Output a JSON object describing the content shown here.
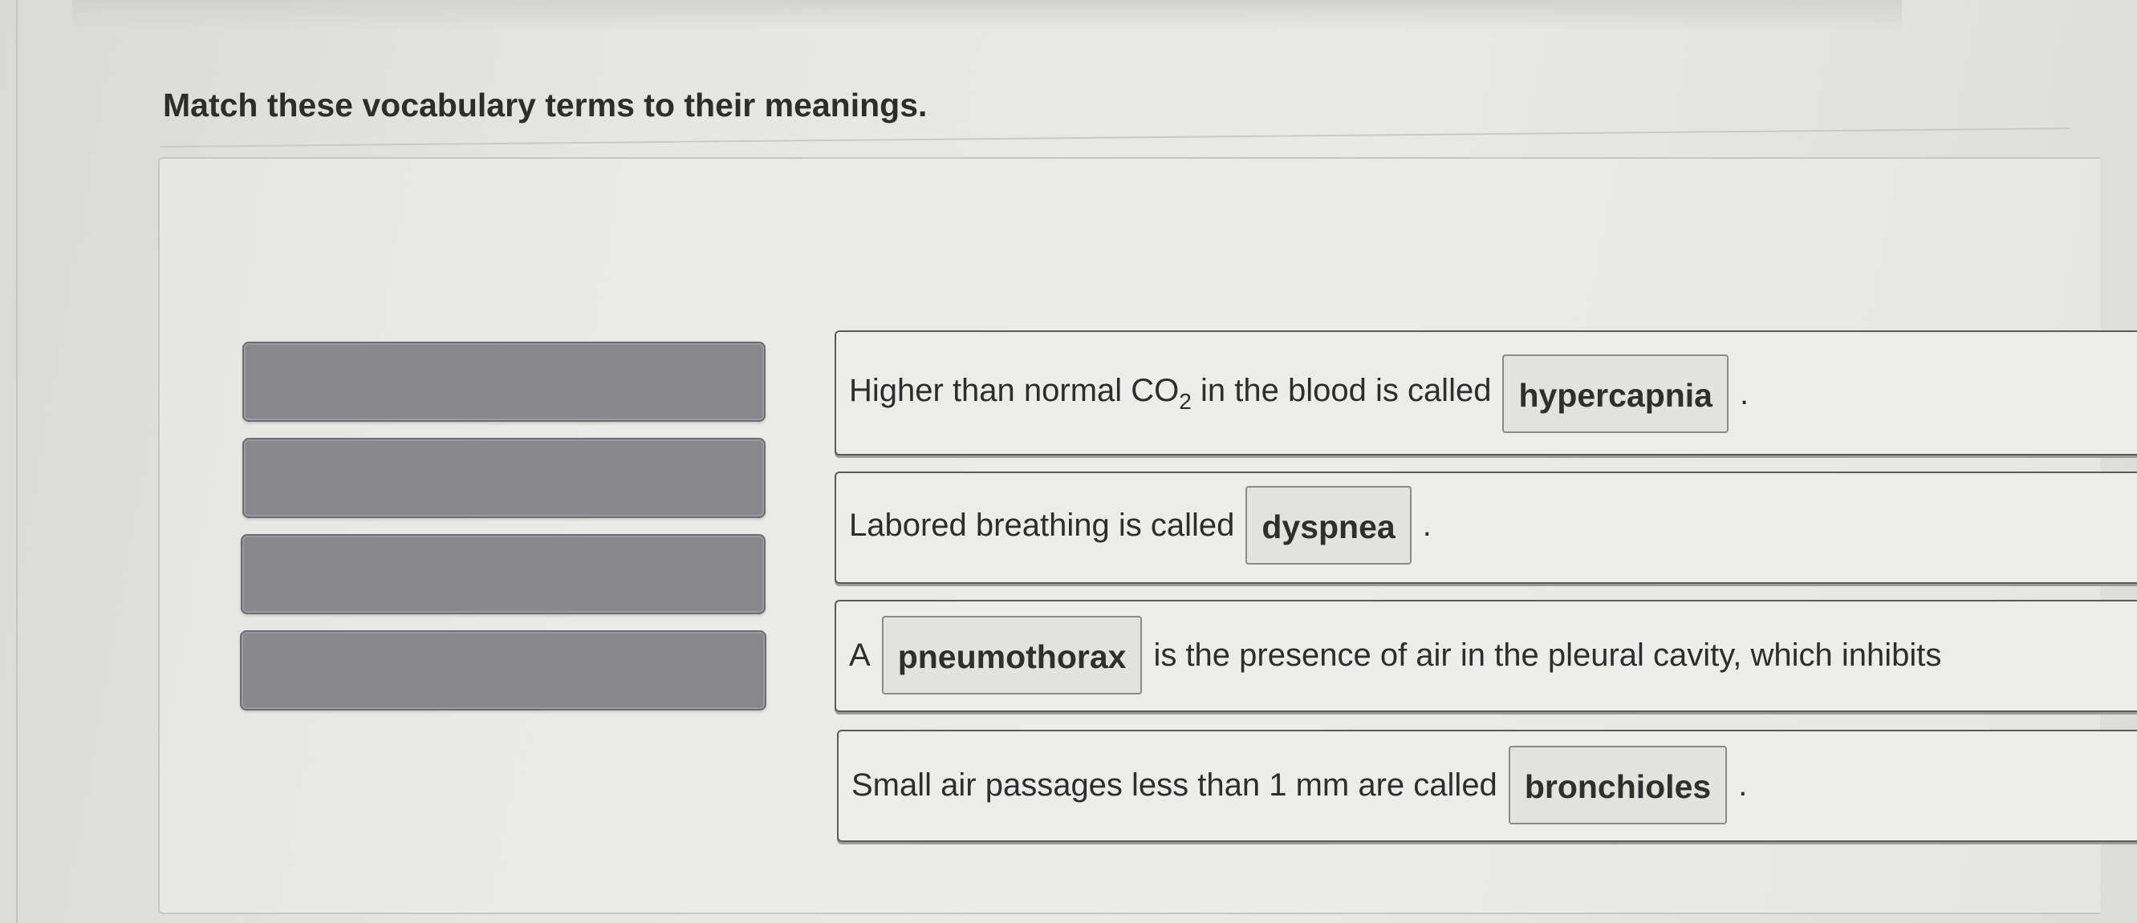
{
  "question": {
    "title": "Match these vocabulary terms to their meanings."
  },
  "term_slots": [
    {
      "state": "empty"
    },
    {
      "state": "empty"
    },
    {
      "state": "empty"
    },
    {
      "state": "empty"
    }
  ],
  "sentences": [
    {
      "before": "Higher than normal CO",
      "subscript": "2",
      "before_tail": " in the blood is called",
      "answer": "hypercapnia",
      "after": "."
    },
    {
      "before": "Labored breathing is called",
      "answer": "dyspnea",
      "after": "."
    },
    {
      "before": "A",
      "answer": "pneumothorax",
      "after": "is the presence of air in the pleural cavity, which inhibits"
    },
    {
      "before": "Small air passages less than 1 mm are called",
      "answer": "bronchioles",
      "after": "."
    }
  ],
  "colors": {
    "slot_fill": "#87878c",
    "card_border": "#5a5a5a",
    "chip_fill": "#e2e2df"
  }
}
